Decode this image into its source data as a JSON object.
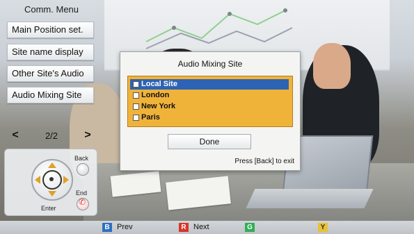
{
  "comm_menu": {
    "title": "Comm. Menu",
    "items": [
      {
        "label": "Main Position set."
      },
      {
        "label": "Site name display"
      },
      {
        "label": "Other Site's Audio"
      },
      {
        "label": "Audio Mixing Site"
      }
    ],
    "pager": {
      "text": "2/2"
    }
  },
  "remote_pad": {
    "back_label": "Back",
    "end_label": "End",
    "enter_label": "Enter"
  },
  "dialog": {
    "title": "Audio Mixing Site",
    "sites": [
      {
        "label": "Local Site",
        "selected": true
      },
      {
        "label": "London",
        "selected": false
      },
      {
        "label": "New York",
        "selected": false
      },
      {
        "label": "Paris",
        "selected": false
      }
    ],
    "done_label": "Done",
    "hint": "Press [Back] to exit"
  },
  "color_keys": [
    {
      "key": "B",
      "label": "Prev",
      "color": "#2d6fc2"
    },
    {
      "key": "R",
      "label": "Next",
      "color": "#d8342b"
    },
    {
      "key": "G",
      "label": "",
      "color": "#2fae55"
    },
    {
      "key": "Y",
      "label": "",
      "color": "#e8c233"
    }
  ]
}
